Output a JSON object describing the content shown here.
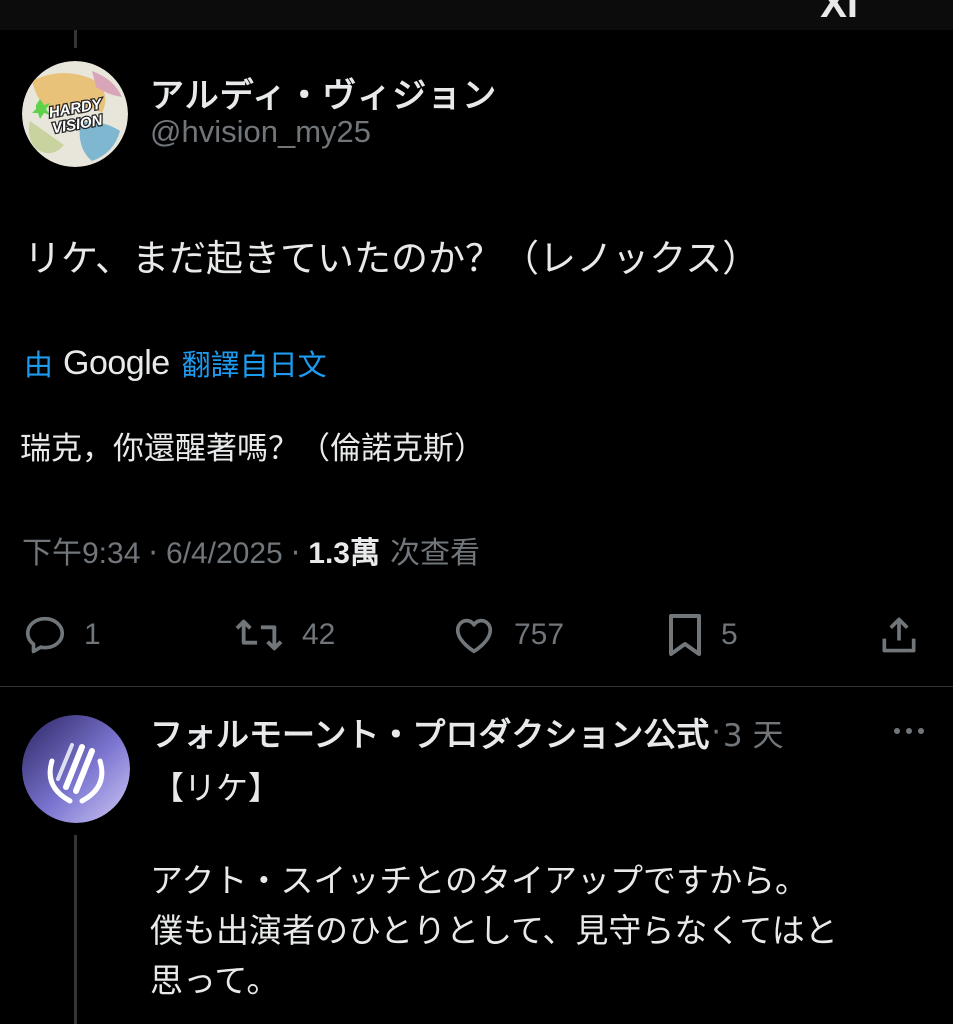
{
  "top_bar": {
    "glyph": "XI"
  },
  "post": {
    "author": {
      "display_name": "アルディ・ヴィジョン",
      "handle": "@hvision_my25",
      "avatar_logo_text": "HARDY VISION",
      "avatar_icon": "hardy-vision-logo"
    },
    "text": "リケ、まだ起きていたのか？（レノックス）",
    "translation": {
      "by_label": "由",
      "service": "Google",
      "from_label": "翻譯自日文",
      "text": "瑞克，你還醒著嗎？（倫諾克斯）"
    },
    "meta": {
      "time": "下午9:34",
      "date": "6/4/2025",
      "views_count": "1.3萬",
      "views_label": "次查看",
      "separator": "·"
    },
    "actions": {
      "reply": {
        "icon": "reply-icon",
        "count": "1"
      },
      "repost": {
        "icon": "repost-icon",
        "count": "42"
      },
      "like": {
        "icon": "heart-icon",
        "count": "757"
      },
      "bookmark": {
        "icon": "bookmark-icon",
        "count": "5"
      },
      "share": {
        "icon": "share-icon"
      }
    }
  },
  "reply": {
    "author": {
      "display_name": "フォルモーント・プロダクション公式",
      "avatar_icon": "formmond-logo"
    },
    "separator": "·",
    "time": "3 天",
    "more_icon": "more-icon",
    "tag": "【リケ】",
    "lines": [
      "アクト・スイッチとのタイアップですから。",
      "僕も出演者のひとりとして、見守らなくてはと",
      "思って。"
    ]
  },
  "colors": {
    "background": "#000000",
    "text_primary": "#e7e9ea",
    "text_secondary": "#71767b",
    "link_blue": "#1d9bf0",
    "divider": "#2f3336"
  }
}
